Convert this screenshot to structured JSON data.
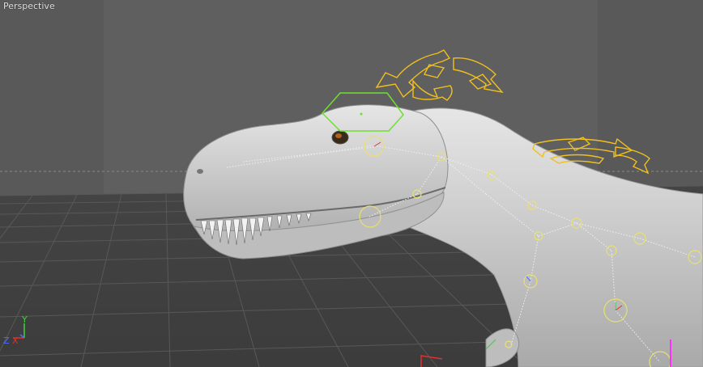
{
  "viewport": {
    "label": "Perspective",
    "background": "#595959",
    "safe_frame_tint": "#5f5f5f"
  },
  "axis_gizmo": {
    "y_label": "Y",
    "x_label": "X",
    "z_label": "Z",
    "colors": {
      "x": "#e03030",
      "y": "#40d040",
      "z": "#4a70ff"
    }
  },
  "colors": {
    "model": "#c9c9c9",
    "joint": "#e8e070",
    "selection": "#6ee030",
    "rotate_handle": "#f0c020"
  },
  "icons": [
    "rotate-handle-icon",
    "axis-gizmo-icon",
    "hexagon-selection-icon"
  ]
}
